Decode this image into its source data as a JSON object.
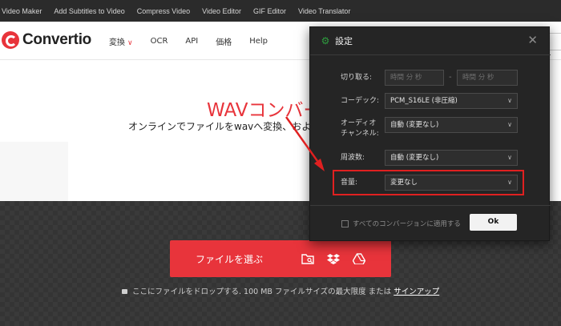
{
  "top_links": [
    "Video Maker",
    "Add Subtitles to Video",
    "Compress Video",
    "Video Editor",
    "GIF Editor",
    "Video Translator"
  ],
  "logo": {
    "name": "Convertio"
  },
  "nav": {
    "convert": "変換",
    "ocr": "OCR",
    "api": "API",
    "pricing": "価格",
    "help": "Help"
  },
  "hero": {
    "title": "WAVコンバー",
    "subtitle": "オンラインでファイルをwavへ変換、およ"
  },
  "upload": {
    "label": "ファイルを選ぶ",
    "note_text": "ここにファイルをドロップする. 100 MB ファイルサイズの最大限度 または",
    "signup": "サインアップ"
  },
  "dialog": {
    "title": "設定",
    "trim_label": "切り取る:",
    "trim_start_placeholder": "時間 分 秒",
    "trim_end_placeholder": "時間 分 秒",
    "trim_dash": "-",
    "codec_label": "コーデック:",
    "codec_value": "PCM_S16LE (非圧縮)",
    "channel_label_1": "オーディオ",
    "channel_label_2": "チャンネル:",
    "channel_value": "自動 (変更なし)",
    "frequency_label": "周波数:",
    "frequency_value": "自動 (変更なし)",
    "volume_label": "音量:",
    "volume_value": "変更なし",
    "apply_all": "すべてのコンバージョンに適用する",
    "ok": "Ok"
  },
  "colors": {
    "brand_red": "#e8343b",
    "dialog_bg": "#252525",
    "highlight": "#e02020",
    "gear_green": "#2e9d3f"
  }
}
